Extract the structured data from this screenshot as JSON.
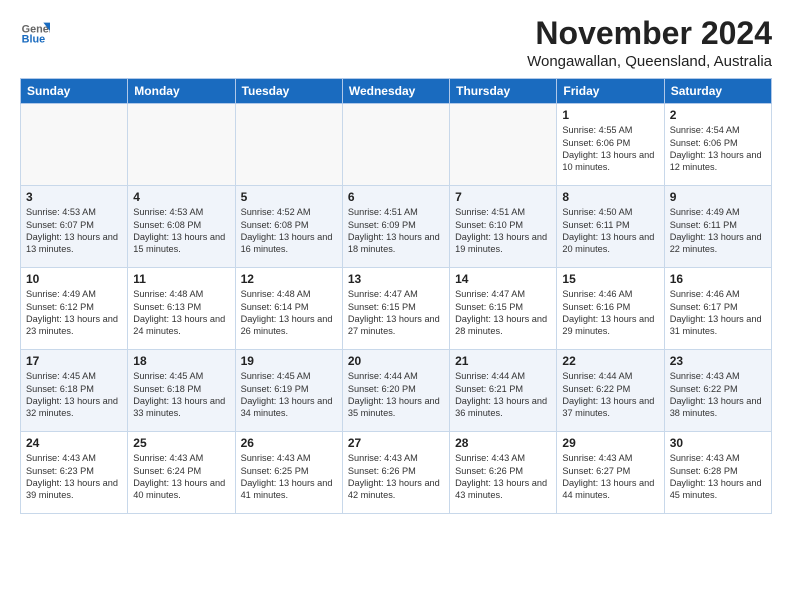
{
  "app": {
    "logo_general": "General",
    "logo_blue": "Blue"
  },
  "header": {
    "month_title": "November 2024",
    "location": "Wongawallan, Queensland, Australia"
  },
  "weekdays": [
    "Sunday",
    "Monday",
    "Tuesday",
    "Wednesday",
    "Thursday",
    "Friday",
    "Saturday"
  ],
  "weeks": [
    [
      {
        "day": "",
        "text": ""
      },
      {
        "day": "",
        "text": ""
      },
      {
        "day": "",
        "text": ""
      },
      {
        "day": "",
        "text": ""
      },
      {
        "day": "",
        "text": ""
      },
      {
        "day": "1",
        "text": "Sunrise: 4:55 AM\nSunset: 6:06 PM\nDaylight: 13 hours and 10 minutes."
      },
      {
        "day": "2",
        "text": "Sunrise: 4:54 AM\nSunset: 6:06 PM\nDaylight: 13 hours and 12 minutes."
      }
    ],
    [
      {
        "day": "3",
        "text": "Sunrise: 4:53 AM\nSunset: 6:07 PM\nDaylight: 13 hours and 13 minutes."
      },
      {
        "day": "4",
        "text": "Sunrise: 4:53 AM\nSunset: 6:08 PM\nDaylight: 13 hours and 15 minutes."
      },
      {
        "day": "5",
        "text": "Sunrise: 4:52 AM\nSunset: 6:08 PM\nDaylight: 13 hours and 16 minutes."
      },
      {
        "day": "6",
        "text": "Sunrise: 4:51 AM\nSunset: 6:09 PM\nDaylight: 13 hours and 18 minutes."
      },
      {
        "day": "7",
        "text": "Sunrise: 4:51 AM\nSunset: 6:10 PM\nDaylight: 13 hours and 19 minutes."
      },
      {
        "day": "8",
        "text": "Sunrise: 4:50 AM\nSunset: 6:11 PM\nDaylight: 13 hours and 20 minutes."
      },
      {
        "day": "9",
        "text": "Sunrise: 4:49 AM\nSunset: 6:11 PM\nDaylight: 13 hours and 22 minutes."
      }
    ],
    [
      {
        "day": "10",
        "text": "Sunrise: 4:49 AM\nSunset: 6:12 PM\nDaylight: 13 hours and 23 minutes."
      },
      {
        "day": "11",
        "text": "Sunrise: 4:48 AM\nSunset: 6:13 PM\nDaylight: 13 hours and 24 minutes."
      },
      {
        "day": "12",
        "text": "Sunrise: 4:48 AM\nSunset: 6:14 PM\nDaylight: 13 hours and 26 minutes."
      },
      {
        "day": "13",
        "text": "Sunrise: 4:47 AM\nSunset: 6:15 PM\nDaylight: 13 hours and 27 minutes."
      },
      {
        "day": "14",
        "text": "Sunrise: 4:47 AM\nSunset: 6:15 PM\nDaylight: 13 hours and 28 minutes."
      },
      {
        "day": "15",
        "text": "Sunrise: 4:46 AM\nSunset: 6:16 PM\nDaylight: 13 hours and 29 minutes."
      },
      {
        "day": "16",
        "text": "Sunrise: 4:46 AM\nSunset: 6:17 PM\nDaylight: 13 hours and 31 minutes."
      }
    ],
    [
      {
        "day": "17",
        "text": "Sunrise: 4:45 AM\nSunset: 6:18 PM\nDaylight: 13 hours and 32 minutes."
      },
      {
        "day": "18",
        "text": "Sunrise: 4:45 AM\nSunset: 6:18 PM\nDaylight: 13 hours and 33 minutes."
      },
      {
        "day": "19",
        "text": "Sunrise: 4:45 AM\nSunset: 6:19 PM\nDaylight: 13 hours and 34 minutes."
      },
      {
        "day": "20",
        "text": "Sunrise: 4:44 AM\nSunset: 6:20 PM\nDaylight: 13 hours and 35 minutes."
      },
      {
        "day": "21",
        "text": "Sunrise: 4:44 AM\nSunset: 6:21 PM\nDaylight: 13 hours and 36 minutes."
      },
      {
        "day": "22",
        "text": "Sunrise: 4:44 AM\nSunset: 6:22 PM\nDaylight: 13 hours and 37 minutes."
      },
      {
        "day": "23",
        "text": "Sunrise: 4:43 AM\nSunset: 6:22 PM\nDaylight: 13 hours and 38 minutes."
      }
    ],
    [
      {
        "day": "24",
        "text": "Sunrise: 4:43 AM\nSunset: 6:23 PM\nDaylight: 13 hours and 39 minutes."
      },
      {
        "day": "25",
        "text": "Sunrise: 4:43 AM\nSunset: 6:24 PM\nDaylight: 13 hours and 40 minutes."
      },
      {
        "day": "26",
        "text": "Sunrise: 4:43 AM\nSunset: 6:25 PM\nDaylight: 13 hours and 41 minutes."
      },
      {
        "day": "27",
        "text": "Sunrise: 4:43 AM\nSunset: 6:26 PM\nDaylight: 13 hours and 42 minutes."
      },
      {
        "day": "28",
        "text": "Sunrise: 4:43 AM\nSunset: 6:26 PM\nDaylight: 13 hours and 43 minutes."
      },
      {
        "day": "29",
        "text": "Sunrise: 4:43 AM\nSunset: 6:27 PM\nDaylight: 13 hours and 44 minutes."
      },
      {
        "day": "30",
        "text": "Sunrise: 4:43 AM\nSunset: 6:28 PM\nDaylight: 13 hours and 45 minutes."
      }
    ]
  ]
}
